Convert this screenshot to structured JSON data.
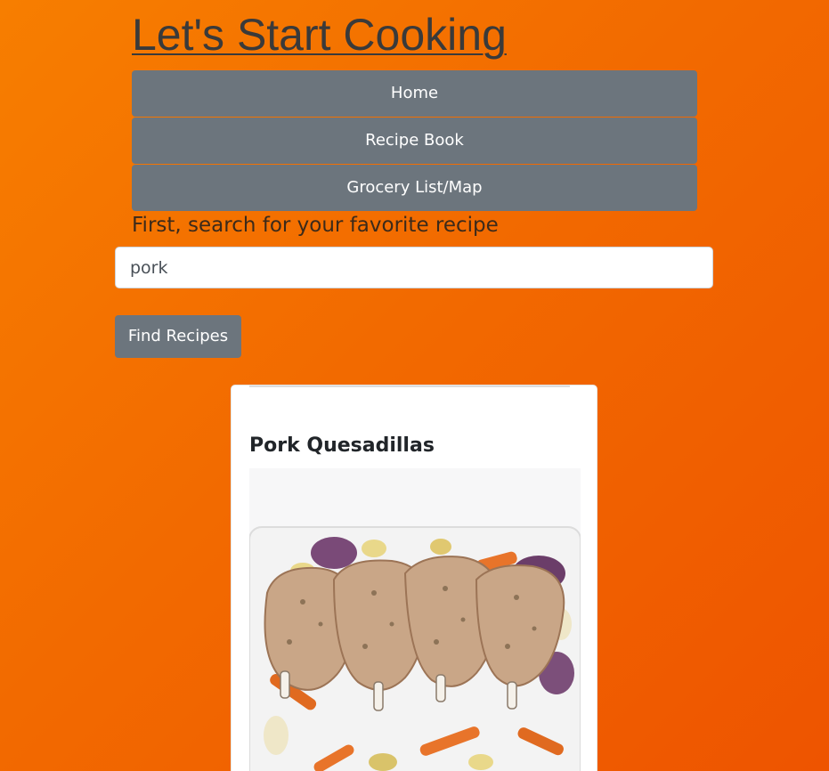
{
  "header": {
    "title": "Let's Start Cooking"
  },
  "nav": {
    "items": [
      {
        "label": "Home"
      },
      {
        "label": "Recipe Book"
      },
      {
        "label": "Grocery List/Map"
      }
    ]
  },
  "search": {
    "prompt": "First, search for your favorite recipe",
    "value": "pork",
    "button_label": "Find Recipes"
  },
  "results": [
    {
      "title": "Pork Quesadillas",
      "image_icon": "pork-chops-photo"
    }
  ],
  "colors": {
    "background_start": "#f77e00",
    "background_end": "#ee5400",
    "button": "#6c757d",
    "card": "#ffffff"
  }
}
